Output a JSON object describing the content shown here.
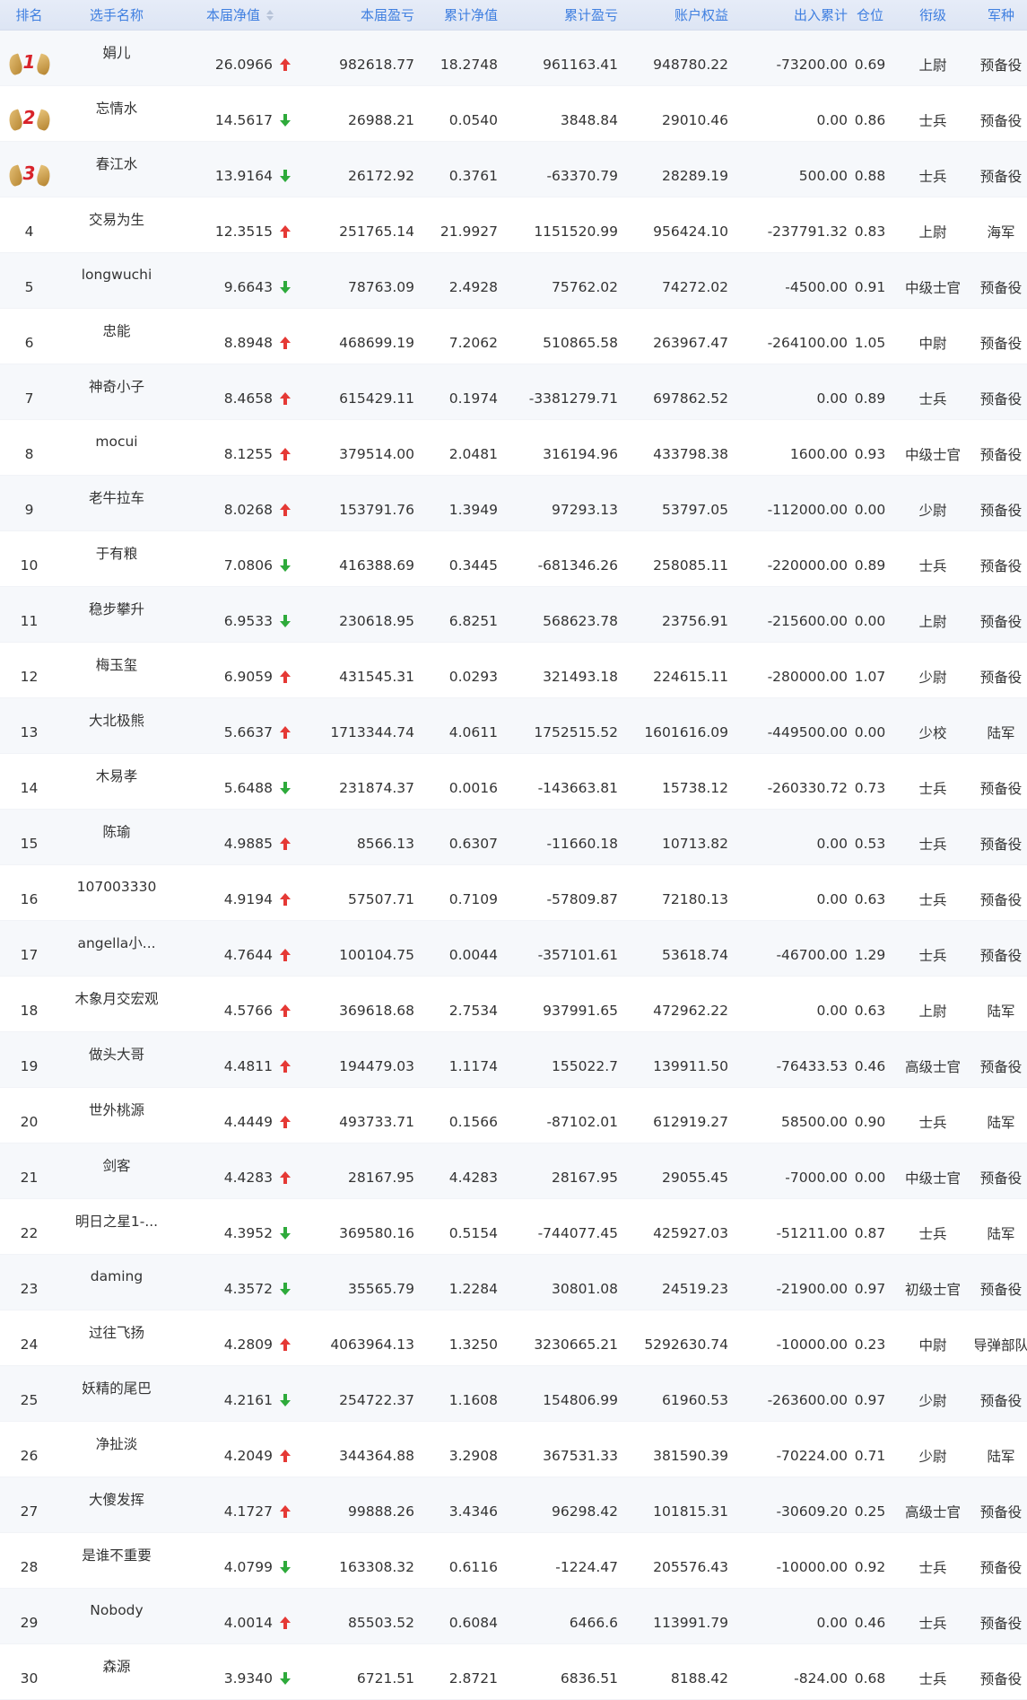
{
  "colors": {
    "header_text": "#3f7fe0",
    "up": "#e53935",
    "down": "#2eaa3b",
    "medal_number": "#d8232a"
  },
  "header": {
    "rank": "排名",
    "name": "选手名称",
    "net_value": "本届净值",
    "pl": "本届盈亏",
    "cum_net": "累计净值",
    "cum_pl": "累计盈亏",
    "equity": "账户权益",
    "inout": "出入累计",
    "position": "仓位",
    "grade": "衔级",
    "army": "军种"
  },
  "rows": [
    {
      "rank": "1",
      "name": "娟儿",
      "nv": "26.0966",
      "dir": "up",
      "pl": "982618.77",
      "cnv": "18.2748",
      "cpl": "961163.41",
      "eq": "948780.22",
      "io": "-73200.00",
      "pos": "0.69",
      "grade": "上尉",
      "army": "预备役"
    },
    {
      "rank": "2",
      "name": "忘情水",
      "nv": "14.5617",
      "dir": "down",
      "pl": "26988.21",
      "cnv": "0.0540",
      "cpl": "3848.84",
      "eq": "29010.46",
      "io": "0.00",
      "pos": "0.86",
      "grade": "士兵",
      "army": "预备役"
    },
    {
      "rank": "3",
      "name": "春江水",
      "nv": "13.9164",
      "dir": "down",
      "pl": "26172.92",
      "cnv": "0.3761",
      "cpl": "-63370.79",
      "eq": "28289.19",
      "io": "500.00",
      "pos": "0.88",
      "grade": "士兵",
      "army": "预备役"
    },
    {
      "rank": "4",
      "name": "交易为生",
      "nv": "12.3515",
      "dir": "up",
      "pl": "251765.14",
      "cnv": "21.9927",
      "cpl": "1151520.99",
      "eq": "956424.10",
      "io": "-237791.32",
      "pos": "0.83",
      "grade": "上尉",
      "army": "海军"
    },
    {
      "rank": "5",
      "name": "longwuchi",
      "nv": "9.6643",
      "dir": "down",
      "pl": "78763.09",
      "cnv": "2.4928",
      "cpl": "75762.02",
      "eq": "74272.02",
      "io": "-4500.00",
      "pos": "0.91",
      "grade": "中级士官",
      "army": "预备役"
    },
    {
      "rank": "6",
      "name": "忠能",
      "nv": "8.8948",
      "dir": "up",
      "pl": "468699.19",
      "cnv": "7.2062",
      "cpl": "510865.58",
      "eq": "263967.47",
      "io": "-264100.00",
      "pos": "1.05",
      "grade": "中尉",
      "army": "预备役"
    },
    {
      "rank": "7",
      "name": "神奇小子",
      "nv": "8.4658",
      "dir": "up",
      "pl": "615429.11",
      "cnv": "0.1974",
      "cpl": "-3381279.71",
      "eq": "697862.52",
      "io": "0.00",
      "pos": "0.89",
      "grade": "士兵",
      "army": "预备役"
    },
    {
      "rank": "8",
      "name": "mocui",
      "nv": "8.1255",
      "dir": "up",
      "pl": "379514.00",
      "cnv": "2.0481",
      "cpl": "316194.96",
      "eq": "433798.38",
      "io": "1600.00",
      "pos": "0.93",
      "grade": "中级士官",
      "army": "预备役"
    },
    {
      "rank": "9",
      "name": "老牛拉车",
      "nv": "8.0268",
      "dir": "up",
      "pl": "153791.76",
      "cnv": "1.3949",
      "cpl": "97293.13",
      "eq": "53797.05",
      "io": "-112000.00",
      "pos": "0.00",
      "grade": "少尉",
      "army": "预备役"
    },
    {
      "rank": "10",
      "name": "于有粮",
      "nv": "7.0806",
      "dir": "down",
      "pl": "416388.69",
      "cnv": "0.3445",
      "cpl": "-681346.26",
      "eq": "258085.11",
      "io": "-220000.00",
      "pos": "0.89",
      "grade": "士兵",
      "army": "预备役"
    },
    {
      "rank": "11",
      "name": "稳步攀升",
      "nv": "6.9533",
      "dir": "down",
      "pl": "230618.95",
      "cnv": "6.8251",
      "cpl": "568623.78",
      "eq": "23756.91",
      "io": "-215600.00",
      "pos": "0.00",
      "grade": "上尉",
      "army": "预备役"
    },
    {
      "rank": "12",
      "name": "梅玉玺",
      "nv": "6.9059",
      "dir": "up",
      "pl": "431545.31",
      "cnv": "0.0293",
      "cpl": "321493.18",
      "eq": "224615.11",
      "io": "-280000.00",
      "pos": "1.07",
      "grade": "少尉",
      "army": "预备役"
    },
    {
      "rank": "13",
      "name": "大北极熊",
      "nv": "5.6637",
      "dir": "up",
      "pl": "1713344.74",
      "cnv": "4.0611",
      "cpl": "1752515.52",
      "eq": "1601616.09",
      "io": "-449500.00",
      "pos": "0.00",
      "grade": "少校",
      "army": "陆军"
    },
    {
      "rank": "14",
      "name": "木易孝",
      "nv": "5.6488",
      "dir": "down",
      "pl": "231874.37",
      "cnv": "0.0016",
      "cpl": "-143663.81",
      "eq": "15738.12",
      "io": "-260330.72",
      "pos": "0.73",
      "grade": "士兵",
      "army": "预备役"
    },
    {
      "rank": "15",
      "name": "陈瑜",
      "nv": "4.9885",
      "dir": "up",
      "pl": "8566.13",
      "cnv": "0.6307",
      "cpl": "-11660.18",
      "eq": "10713.82",
      "io": "0.00",
      "pos": "0.53",
      "grade": "士兵",
      "army": "预备役"
    },
    {
      "rank": "16",
      "name": "107003330",
      "nv": "4.9194",
      "dir": "up",
      "pl": "57507.71",
      "cnv": "0.7109",
      "cpl": "-57809.87",
      "eq": "72180.13",
      "io": "0.00",
      "pos": "0.63",
      "grade": "士兵",
      "army": "预备役"
    },
    {
      "rank": "17",
      "name": "angella小...",
      "nv": "4.7644",
      "dir": "up",
      "pl": "100104.75",
      "cnv": "0.0044",
      "cpl": "-357101.61",
      "eq": "53618.74",
      "io": "-46700.00",
      "pos": "1.29",
      "grade": "士兵",
      "army": "预备役"
    },
    {
      "rank": "18",
      "name": "木象月交宏观",
      "nv": "4.5766",
      "dir": "up",
      "pl": "369618.68",
      "cnv": "2.7534",
      "cpl": "937991.65",
      "eq": "472962.22",
      "io": "0.00",
      "pos": "0.63",
      "grade": "上尉",
      "army": "陆军"
    },
    {
      "rank": "19",
      "name": "做头大哥",
      "nv": "4.4811",
      "dir": "up",
      "pl": "194479.03",
      "cnv": "1.1174",
      "cpl": "155022.7",
      "eq": "139911.50",
      "io": "-76433.53",
      "pos": "0.46",
      "grade": "高级士官",
      "army": "预备役"
    },
    {
      "rank": "20",
      "name": "世外桃源",
      "nv": "4.4449",
      "dir": "up",
      "pl": "493733.71",
      "cnv": "0.1566",
      "cpl": "-87102.01",
      "eq": "612919.27",
      "io": "58500.00",
      "pos": "0.90",
      "grade": "士兵",
      "army": "陆军"
    },
    {
      "rank": "21",
      "name": "剑客",
      "nv": "4.4283",
      "dir": "up",
      "pl": "28167.95",
      "cnv": "4.4283",
      "cpl": "28167.95",
      "eq": "29055.45",
      "io": "-7000.00",
      "pos": "0.00",
      "grade": "中级士官",
      "army": "预备役"
    },
    {
      "rank": "22",
      "name": "明日之星1-...",
      "nv": "4.3952",
      "dir": "down",
      "pl": "369580.16",
      "cnv": "0.5154",
      "cpl": "-744077.45",
      "eq": "425927.03",
      "io": "-51211.00",
      "pos": "0.87",
      "grade": "士兵",
      "army": "陆军"
    },
    {
      "rank": "23",
      "name": "daming",
      "nv": "4.3572",
      "dir": "down",
      "pl": "35565.79",
      "cnv": "1.2284",
      "cpl": "30801.08",
      "eq": "24519.23",
      "io": "-21900.00",
      "pos": "0.97",
      "grade": "初级士官",
      "army": "预备役"
    },
    {
      "rank": "24",
      "name": "过往飞扬",
      "nv": "4.2809",
      "dir": "up",
      "pl": "4063964.13",
      "cnv": "1.3250",
      "cpl": "3230665.21",
      "eq": "5292630.74",
      "io": "-10000.00",
      "pos": "0.23",
      "grade": "中尉",
      "army": "导弹部队"
    },
    {
      "rank": "25",
      "name": "妖精的尾巴",
      "nv": "4.2161",
      "dir": "down",
      "pl": "254722.37",
      "cnv": "1.1608",
      "cpl": "154806.99",
      "eq": "61960.53",
      "io": "-263600.00",
      "pos": "0.97",
      "grade": "少尉",
      "army": "预备役"
    },
    {
      "rank": "26",
      "name": "净扯淡",
      "nv": "4.2049",
      "dir": "up",
      "pl": "344364.88",
      "cnv": "3.2908",
      "cpl": "367531.33",
      "eq": "381590.39",
      "io": "-70224.00",
      "pos": "0.71",
      "grade": "少尉",
      "army": "陆军"
    },
    {
      "rank": "27",
      "name": "大傻发挥",
      "nv": "4.1727",
      "dir": "up",
      "pl": "99888.26",
      "cnv": "3.4346",
      "cpl": "96298.42",
      "eq": "101815.31",
      "io": "-30609.20",
      "pos": "0.25",
      "grade": "高级士官",
      "army": "预备役"
    },
    {
      "rank": "28",
      "name": "是谁不重要",
      "nv": "4.0799",
      "dir": "down",
      "pl": "163308.32",
      "cnv": "0.6116",
      "cpl": "-1224.47",
      "eq": "205576.43",
      "io": "-10000.00",
      "pos": "0.92",
      "grade": "士兵",
      "army": "预备役"
    },
    {
      "rank": "29",
      "name": "Nobody",
      "nv": "4.0014",
      "dir": "up",
      "pl": "85503.52",
      "cnv": "0.6084",
      "cpl": "6466.6",
      "eq": "113991.79",
      "io": "0.00",
      "pos": "0.46",
      "grade": "士兵",
      "army": "预备役"
    },
    {
      "rank": "30",
      "name": "森源",
      "nv": "3.9340",
      "dir": "down",
      "pl": "6721.51",
      "cnv": "2.8721",
      "cpl": "6836.51",
      "eq": "8188.42",
      "io": "-824.00",
      "pos": "0.68",
      "grade": "士兵",
      "army": "预备役"
    }
  ]
}
